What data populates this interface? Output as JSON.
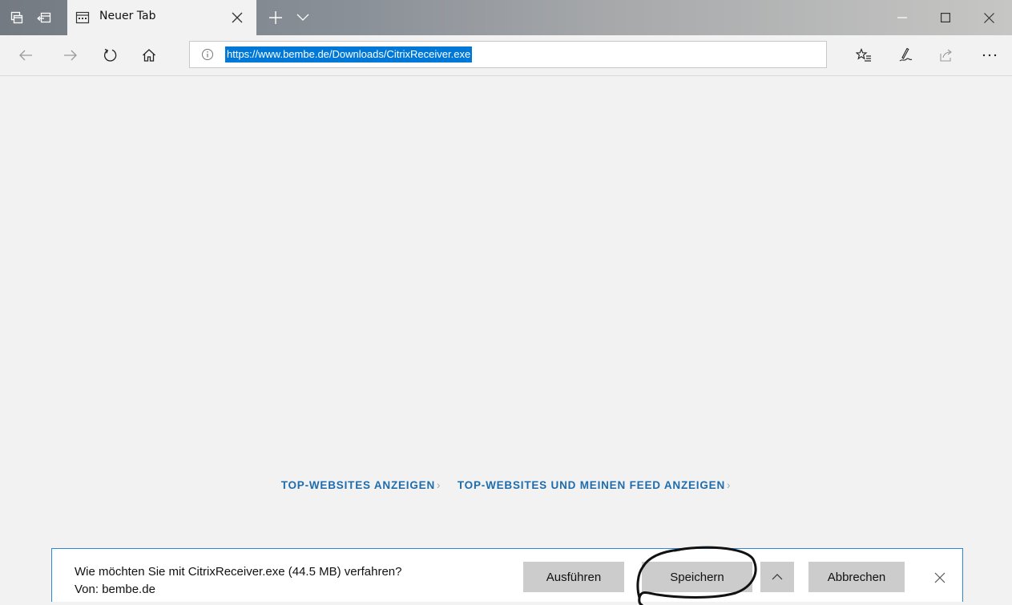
{
  "browser": {
    "tab": {
      "title": "Neuer Tab",
      "icon": "new-tab-page-icon"
    },
    "address": {
      "url": "https://www.bembe.de/Downloads/CitrixReceiver.exe",
      "info_icon": "info-icon"
    },
    "titlebar_icons": [
      "set-aside-tabs-icon",
      "restore-tabs-icon"
    ],
    "nav_icons": [
      "back-arrow-icon",
      "forward-arrow-icon",
      "refresh-icon",
      "home-icon"
    ],
    "toolbar_icons": [
      "favorites-hub-icon",
      "web-note-pen-icon",
      "share-icon",
      "more-dots-icon"
    ],
    "window_icons": [
      "minimize-icon",
      "maximize-icon",
      "close-icon"
    ]
  },
  "page": {
    "links": [
      {
        "label": "TOP-WEBSITES ANZEIGEN",
        "chevron": "›"
      },
      {
        "label": "TOP-WEBSITES UND MEINEN FEED ANZEIGEN",
        "chevron": "›"
      }
    ]
  },
  "download_bar": {
    "question": "Wie möchten Sie mit CitrixReceiver.exe (44.5 MB) verfahren?",
    "source": "Von: bembe.de",
    "run_label": "Ausführen",
    "save_label": "Speichern",
    "options_icon": "chevron-up-icon",
    "cancel_label": "Abbrechen",
    "close_icon": "close-icon"
  },
  "colors": {
    "accent": "#0078d7",
    "link": "#1e6cad",
    "download_border": "#2b88d8",
    "button_bg": "#cccccc"
  }
}
